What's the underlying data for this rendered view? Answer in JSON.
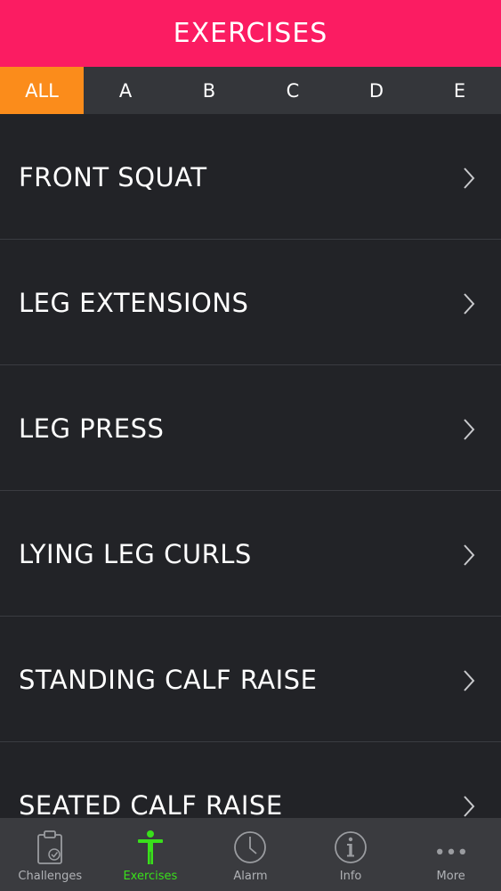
{
  "header": {
    "title": "EXERCISES"
  },
  "filter_tabs": [
    {
      "label": "ALL",
      "active": true
    },
    {
      "label": "A",
      "active": false
    },
    {
      "label": "B",
      "active": false
    },
    {
      "label": "C",
      "active": false
    },
    {
      "label": "D",
      "active": false
    },
    {
      "label": "E",
      "active": false
    }
  ],
  "exercises": [
    {
      "label": "FRONT SQUAT"
    },
    {
      "label": "LEG EXTENSIONS"
    },
    {
      "label": "LEG PRESS"
    },
    {
      "label": "LYING LEG CURLS"
    },
    {
      "label": "STANDING CALF RAISE"
    },
    {
      "label": "SEATED CALF RAISE"
    }
  ],
  "tab_bar": [
    {
      "label": "Challenges",
      "icon": "clipboard-check-icon",
      "active": false
    },
    {
      "label": "Exercises",
      "icon": "person-icon",
      "active": true
    },
    {
      "label": "Alarm",
      "icon": "clock-icon",
      "active": false
    },
    {
      "label": "Info",
      "icon": "info-icon",
      "active": false
    },
    {
      "label": "More",
      "icon": "more-dots-icon",
      "active": false
    }
  ],
  "colors": {
    "header_bg": "#fb1c62",
    "active_tab_bg": "#fb8c1b",
    "list_bg": "#222327",
    "tab_bar_bg": "#3a3b3f",
    "active_tab_bar_label": "#39e01b"
  }
}
